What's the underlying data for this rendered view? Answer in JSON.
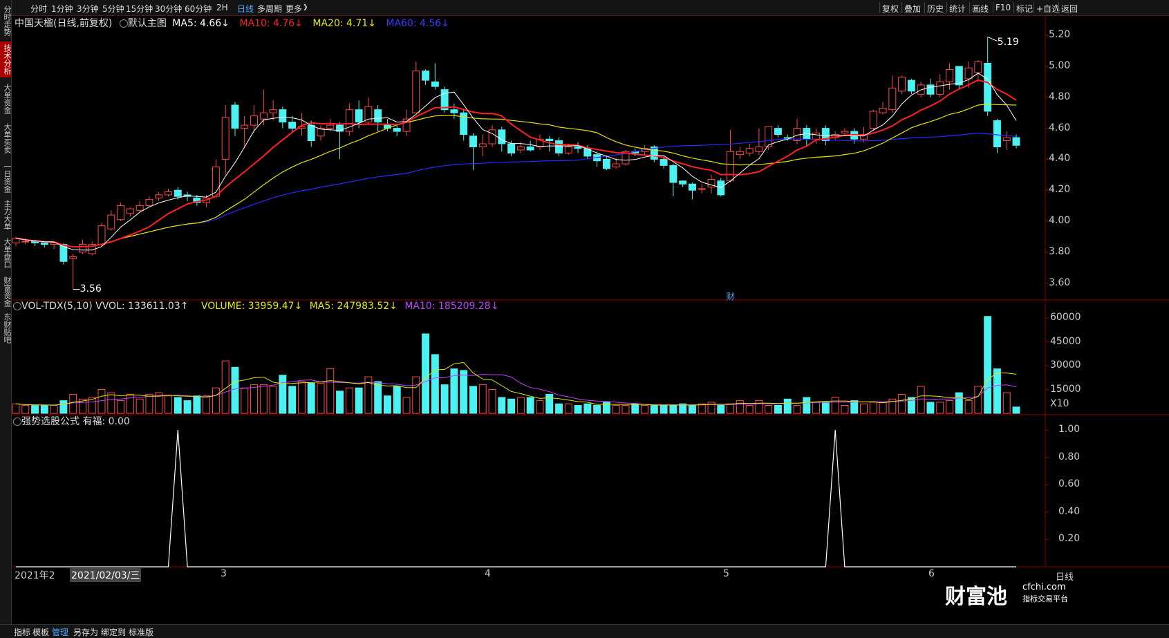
{
  "toolbar": {
    "tabs": [
      "分时",
      "1分钟",
      "3分钟",
      "5分钟",
      "15分钟",
      "30分钟",
      "60分钟",
      "2H",
      "日线",
      "多周期",
      "更多"
    ],
    "active_tab": "日线",
    "right": [
      "复权",
      "叠加",
      "历史",
      "统计",
      "画线",
      "F10",
      "标记",
      "+自选",
      "返回"
    ]
  },
  "left_tabs": [
    "分时走势",
    "技术分析",
    "大单资金",
    "大单买卖",
    "一日资金",
    "主力大单",
    "大单盘口",
    "财富资金",
    "东财贴吧"
  ],
  "left_active": "技术分析",
  "main_legend": {
    "title": "中国天楹(日线,前复权)",
    "template": "默认主图",
    "ma5": "MA5: 4.66↓",
    "ma10": "MA10: 4.76↓",
    "ma20": "MA20: 4.71↓",
    "ma60": "MA60: 4.56↓"
  },
  "vol_legend": {
    "name": "VOL-TDX(5,10) VVOL: 133611.03↑",
    "volume": "VOLUME: 33959.47↓",
    "ma5": "MA5: 247983.52↓",
    "ma10": "MA10: 185209.28↓"
  },
  "ind_legend": {
    "name": "强势选股公式 有福: 0.00"
  },
  "annotations": {
    "high": "5.19",
    "low": "3.56",
    "event_marker": "财"
  },
  "price_axis": [
    "5.20",
    "5.00",
    "4.80",
    "4.60",
    "4.40",
    "4.20",
    "4.00",
    "3.80",
    "3.60"
  ],
  "vol_axis": [
    "60000",
    "45000",
    "30000",
    "15000",
    "X10"
  ],
  "ind_axis": [
    "1.00",
    "0.80",
    "0.60",
    "0.40",
    "0.20"
  ],
  "x_axis": {
    "start": "2021年2",
    "cursor": "2021/02/03/三",
    "months": [
      "3",
      "4",
      "5",
      "6"
    ],
    "period": "日线"
  },
  "bottom_bar": [
    "指标",
    "模板",
    "管理",
    "另存为",
    "绑定到",
    "标准版"
  ],
  "bottom_active": "管理",
  "logo": {
    "main": "财富池",
    "domain": "cfchi.com",
    "sub": "指标交易平台"
  },
  "colors": {
    "up": "#ff4b4b",
    "down": "#4cf2f2",
    "ma5": "#ffffff",
    "ma10": "#ff2020",
    "ma20": "#e6e600",
    "ma60": "#2a2aff",
    "vma5": "#e6e600",
    "vma10": "#c040ff"
  },
  "chart_data": {
    "type": "candlestick",
    "price_range": [
      3.5,
      5.25
    ],
    "vol_range": [
      0,
      60000
    ],
    "ind_range": [
      0,
      1
    ],
    "candles": [
      [
        3.86,
        3.89,
        3.84,
        3.9
      ],
      [
        3.87,
        3.87,
        3.85,
        3.89
      ],
      [
        3.87,
        3.86,
        3.84,
        3.88
      ],
      [
        3.86,
        3.85,
        3.83,
        3.87
      ],
      [
        3.85,
        3.86,
        3.82,
        3.87
      ],
      [
        3.85,
        3.74,
        3.72,
        3.86
      ],
      [
        3.76,
        3.77,
        3.56,
        3.79
      ],
      [
        3.8,
        3.85,
        3.79,
        3.88
      ],
      [
        3.79,
        3.85,
        3.78,
        3.87
      ],
      [
        3.85,
        3.97,
        3.84,
        3.99
      ],
      [
        3.95,
        4.04,
        3.94,
        4.07
      ],
      [
        4.01,
        4.1,
        4.0,
        4.12
      ],
      [
        4.05,
        4.08,
        4.03,
        4.09
      ],
      [
        4.07,
        4.1,
        4.06,
        4.13
      ],
      [
        4.1,
        4.14,
        4.09,
        4.16
      ],
      [
        4.15,
        4.17,
        4.13,
        4.19
      ],
      [
        4.17,
        4.19,
        4.16,
        4.21
      ],
      [
        4.2,
        4.16,
        4.14,
        4.22
      ],
      [
        4.17,
        4.16,
        4.13,
        4.19
      ],
      [
        4.15,
        4.12,
        4.1,
        4.17
      ],
      [
        4.12,
        4.15,
        4.09,
        4.17
      ],
      [
        4.16,
        4.35,
        4.15,
        4.4
      ],
      [
        4.4,
        4.67,
        4.3,
        4.75
      ],
      [
        4.75,
        4.6,
        4.55,
        4.77
      ],
      [
        4.6,
        4.62,
        4.48,
        4.68
      ],
      [
        4.62,
        4.68,
        4.58,
        4.75
      ],
      [
        4.66,
        4.7,
        4.62,
        4.85
      ],
      [
        4.7,
        4.72,
        4.65,
        4.78
      ],
      [
        4.72,
        4.64,
        4.6,
        4.74
      ],
      [
        4.64,
        4.6,
        4.57,
        4.68
      ],
      [
        4.6,
        4.61,
        4.55,
        4.7
      ],
      [
        4.62,
        4.52,
        4.48,
        4.65
      ],
      [
        4.55,
        4.6,
        4.52,
        4.62
      ],
      [
        4.6,
        4.62,
        4.58,
        4.66
      ],
      [
        4.62,
        4.58,
        4.4,
        4.64
      ],
      [
        4.58,
        4.72,
        4.55,
        4.76
      ],
      [
        4.72,
        4.64,
        4.6,
        4.78
      ],
      [
        4.64,
        4.74,
        4.62,
        4.8
      ],
      [
        4.72,
        4.64,
        4.58,
        4.75
      ],
      [
        4.62,
        4.6,
        4.58,
        4.66
      ],
      [
        4.6,
        4.58,
        4.55,
        4.63
      ],
      [
        4.58,
        4.66,
        4.55,
        4.72
      ],
      [
        4.7,
        4.97,
        4.7,
        5.03
      ],
      [
        4.97,
        4.91,
        4.88,
        4.98
      ],
      [
        4.9,
        4.87,
        4.85,
        5.02
      ],
      [
        4.85,
        4.72,
        4.7,
        4.87
      ],
      [
        4.72,
        4.7,
        4.66,
        4.76
      ],
      [
        4.7,
        4.56,
        4.52,
        4.72
      ],
      [
        4.55,
        4.48,
        4.33,
        4.57
      ],
      [
        4.48,
        4.5,
        4.42,
        4.56
      ],
      [
        4.5,
        4.59,
        4.48,
        4.62
      ],
      [
        4.59,
        4.5,
        4.45,
        4.61
      ],
      [
        4.5,
        4.44,
        4.42,
        4.52
      ],
      [
        4.46,
        4.48,
        4.44,
        4.51
      ],
      [
        4.48,
        4.46,
        4.45,
        4.52
      ],
      [
        4.48,
        4.53,
        4.46,
        4.56
      ],
      [
        4.53,
        4.52,
        4.45,
        4.55
      ],
      [
        4.52,
        4.44,
        4.42,
        4.54
      ],
      [
        4.44,
        4.48,
        4.43,
        4.5
      ],
      [
        4.48,
        4.47,
        4.44,
        4.51
      ],
      [
        4.47,
        4.42,
        4.4,
        4.49
      ],
      [
        4.43,
        4.39,
        4.35,
        4.45
      ],
      [
        4.4,
        4.34,
        4.33,
        4.42
      ],
      [
        4.35,
        4.37,
        4.34,
        4.41
      ],
      [
        4.37,
        4.45,
        4.36,
        4.46
      ],
      [
        4.45,
        4.44,
        4.42,
        4.47
      ],
      [
        4.45,
        4.47,
        4.43,
        4.49
      ],
      [
        4.48,
        4.4,
        4.38,
        4.49
      ],
      [
        4.4,
        4.36,
        4.34,
        4.42
      ],
      [
        4.36,
        4.25,
        4.16,
        4.37
      ],
      [
        4.26,
        4.24,
        4.22,
        4.26
      ],
      [
        4.24,
        4.2,
        4.14,
        4.25
      ],
      [
        4.21,
        4.21,
        4.18,
        4.24
      ],
      [
        4.22,
        4.27,
        4.18,
        4.3
      ],
      [
        4.26,
        4.17,
        4.16,
        4.28
      ],
      [
        4.26,
        4.45,
        4.25,
        4.59
      ],
      [
        4.43,
        4.45,
        4.4,
        4.48
      ],
      [
        4.44,
        4.47,
        4.42,
        4.5
      ],
      [
        4.45,
        4.48,
        4.43,
        4.6
      ],
      [
        4.48,
        4.61,
        4.46,
        4.61
      ],
      [
        4.6,
        4.56,
        4.54,
        4.62
      ],
      [
        4.54,
        4.53,
        4.52,
        4.56
      ],
      [
        4.52,
        4.6,
        4.5,
        4.66
      ],
      [
        4.6,
        4.53,
        4.48,
        4.62
      ],
      [
        4.53,
        4.57,
        4.5,
        4.6
      ],
      [
        4.6,
        4.52,
        4.49,
        4.62
      ],
      [
        4.54,
        4.56,
        4.52,
        4.58
      ],
      [
        4.57,
        4.58,
        4.55,
        4.6
      ],
      [
        4.58,
        4.53,
        4.5,
        4.6
      ],
      [
        4.53,
        4.56,
        4.51,
        4.61
      ],
      [
        4.6,
        4.71,
        4.58,
        4.72
      ],
      [
        4.7,
        4.73,
        4.69,
        4.77
      ],
      [
        4.72,
        4.86,
        4.7,
        4.94
      ],
      [
        4.84,
        4.93,
        4.82,
        4.94
      ],
      [
        4.91,
        4.84,
        4.82,
        4.92
      ],
      [
        4.82,
        4.88,
        4.8,
        4.9
      ],
      [
        4.88,
        4.82,
        4.8,
        4.92
      ],
      [
        4.82,
        4.9,
        4.8,
        4.95
      ],
      [
        4.9,
        4.98,
        4.85,
        5.02
      ],
      [
        5.0,
        4.88,
        4.85,
        5.0
      ],
      [
        4.92,
        4.99,
        4.86,
        5.03
      ],
      [
        4.96,
        5.03,
        4.9,
        5.04
      ],
      [
        5.02,
        4.71,
        4.68,
        5.19
      ],
      [
        4.65,
        4.48,
        4.44,
        4.66
      ],
      [
        4.52,
        4.54,
        4.46,
        4.58
      ],
      [
        4.54,
        4.49,
        4.47,
        4.56
      ]
    ],
    "volume": [
      6,
      5,
      5,
      5,
      5,
      8,
      12,
      9,
      10,
      15,
      13,
      8,
      12,
      9,
      12,
      13,
      11,
      10,
      8,
      11,
      11,
      16,
      33,
      29,
      16,
      18,
      18,
      17,
      24,
      17,
      20,
      19,
      19,
      28,
      14,
      16,
      16,
      23,
      20,
      11,
      17,
      10,
      23,
      50,
      37,
      18,
      28,
      27,
      17,
      18,
      15,
      10,
      9,
      10,
      10,
      8,
      12,
      6,
      6,
      5,
      6,
      5,
      7,
      5,
      5,
      6,
      5,
      5,
      5,
      5,
      6,
      5,
      6,
      7,
      5,
      6,
      8,
      5,
      8,
      5,
      5,
      9,
      5,
      10,
      7,
      7,
      10,
      5,
      8,
      6,
      7,
      7,
      9,
      12,
      10,
      17,
      7,
      7,
      8,
      13,
      8,
      17,
      61,
      28,
      13,
      4
    ],
    "indicator_peaks": [
      17,
      86
    ]
  }
}
